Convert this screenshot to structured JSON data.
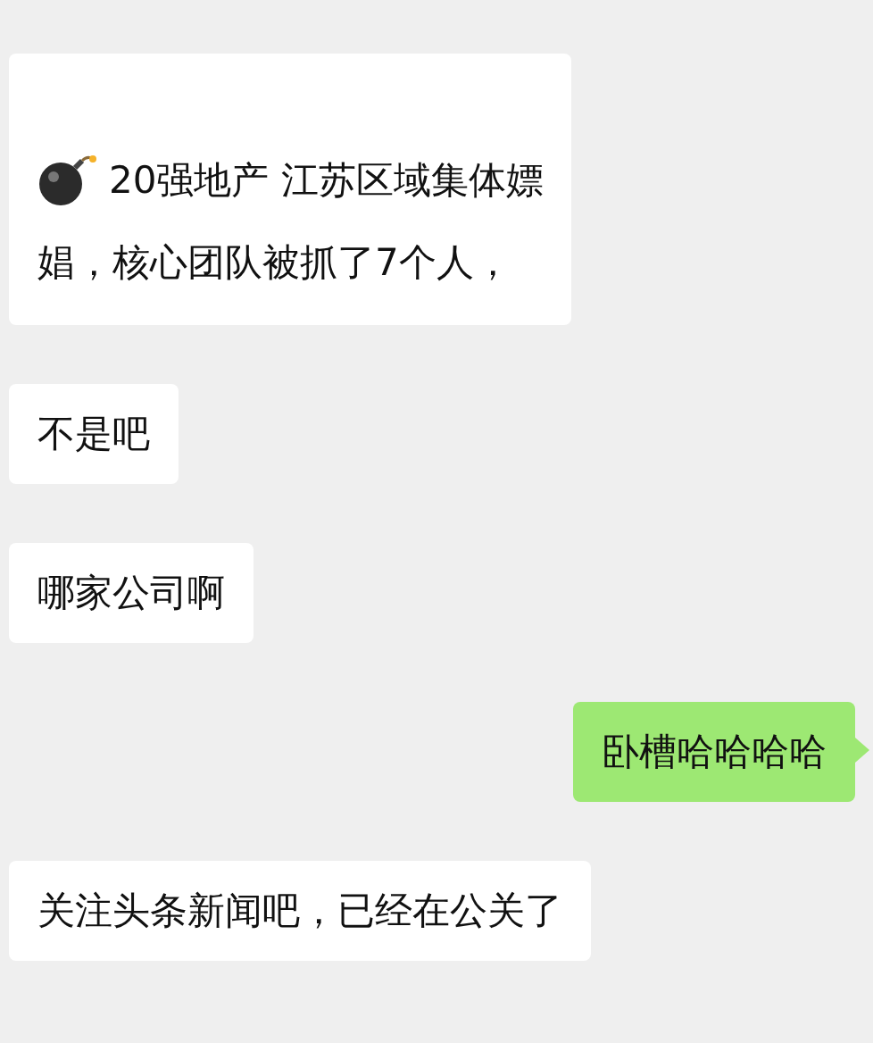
{
  "messages": [
    {
      "outgoing": false,
      "bomb_icon": true,
      "lines": [
        "20强地产 江苏区域集体嫖",
        "娼，核心团队被抓了7个人，"
      ]
    },
    {
      "outgoing": false,
      "lines": [
        "不是吧"
      ]
    },
    {
      "outgoing": false,
      "lines": [
        "哪家公司啊"
      ]
    },
    {
      "outgoing": true,
      "lines": [
        "卧槽哈哈哈哈"
      ]
    },
    {
      "outgoing": false,
      "lines": [
        "关注头条新闻吧，已经在公关了"
      ]
    }
  ]
}
